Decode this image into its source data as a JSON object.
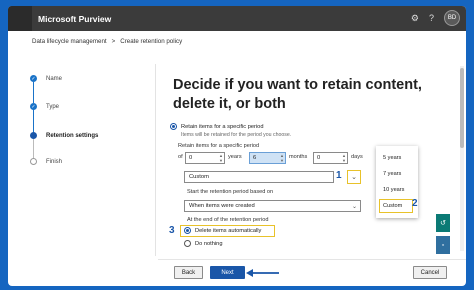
{
  "app": {
    "title": "Microsoft Purview"
  },
  "topbar": {
    "icons": [
      "gear-icon",
      "help-icon"
    ],
    "avatar": "BD"
  },
  "breadcrumb": {
    "items": [
      "Data lifecycle management",
      ">",
      "Create retention policy"
    ]
  },
  "steps": [
    {
      "label": "Name",
      "state": "done"
    },
    {
      "label": "Type",
      "state": "done"
    },
    {
      "label": "Retention settings",
      "state": "current"
    },
    {
      "label": "Finish",
      "state": "todo"
    }
  ],
  "main": {
    "heading": "Decide if you want to retain content, delete it, or both",
    "retain_option": {
      "label": "Retain items for a specific period",
      "sublabel": "Items will be retained for the period you choose."
    },
    "period_label": "Retain items for a specific period",
    "period": {
      "of": "of",
      "years_value": "0",
      "years_unit": "years",
      "months_value": "6",
      "months_unit": "months",
      "days_value": "0",
      "days_unit": "days"
    },
    "period_dropdown": {
      "value": "Custom"
    },
    "start_label": "Start the retention period based on",
    "start_dropdown": {
      "value": "When items were created"
    },
    "end_label": "At the end of the retention period",
    "delete_option": {
      "label": "Delete items automatically"
    },
    "nothing_option": {
      "label": "Do nothing"
    }
  },
  "dropdown_menu": {
    "options": [
      "5 years",
      "7 years",
      "10 years",
      "Custom"
    ]
  },
  "annotations": {
    "one": "1",
    "two": "2",
    "three": "3"
  },
  "footer": {
    "back": "Back",
    "next": "Next",
    "cancel": "Cancel"
  },
  "colors": {
    "accent": "#1a56a8",
    "highlight": "#e8c22a",
    "topbar": "#3b3b3b",
    "teal": "#0b7a75"
  }
}
